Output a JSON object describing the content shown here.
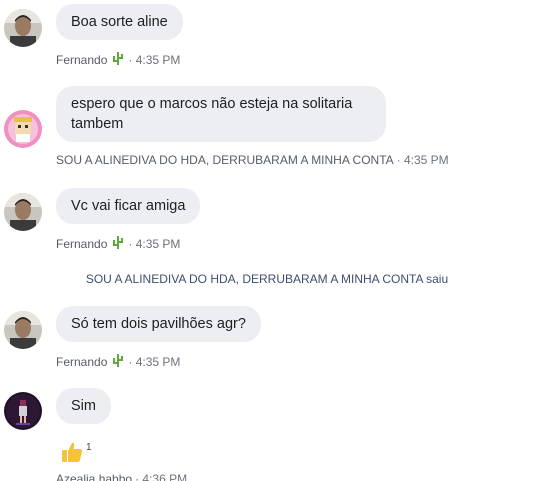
{
  "messages": [
    {
      "text": "Boa sorte aline",
      "author": "Fernando",
      "author_icon": "cactus-emoji",
      "time": "· 4:35 PM"
    },
    {
      "text": "espero que o marcos não esteja na solitaria tambem",
      "author": "SOU A ALINEDIVA DO HDA, DERRUBARAM A MINHA CONTA",
      "time": "· 4:35 PM"
    },
    {
      "text": "Vc vai ficar amiga",
      "author": "Fernando",
      "author_icon": "cactus-emoji",
      "time": "· 4:35 PM"
    },
    {
      "text": "Só tem dois pavilhões agr?",
      "author": "Fernando",
      "author_icon": "cactus-emoji",
      "time": "· 4:35 PM"
    },
    {
      "text": "Sim",
      "author": "Azealia habbo",
      "time": "· 4:36 PM",
      "reaction": {
        "icon": "thumbs-up-emoji",
        "count": "1"
      }
    }
  ],
  "system_notice": "SOU A ALINEDIVA DO HDA, DERRUBARAM A MINHA CONTA saiu",
  "colors": {
    "bubble": "#eceef1",
    "meta_author": "#555d68",
    "system_text": "#3d4f6e",
    "cactus": "#5fa83b",
    "thumbs_up": "#f5c33b"
  }
}
